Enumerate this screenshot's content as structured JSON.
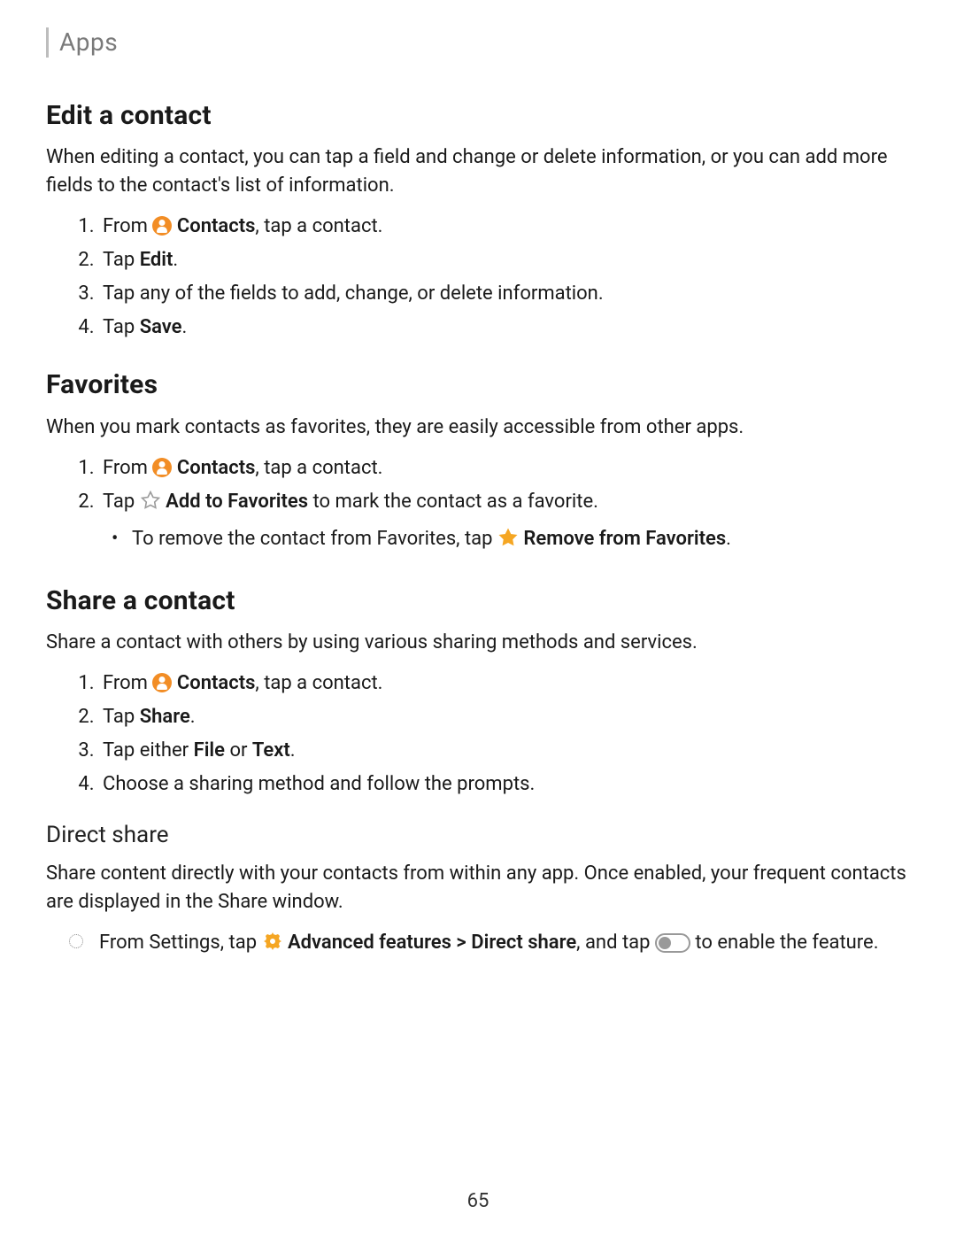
{
  "breadcrumb": "Apps",
  "page_number": "65",
  "sections": {
    "edit": {
      "title": "Edit a contact",
      "intro": "When editing a contact, you can tap a field and change or delete information, or you can add more fields to the contact's list of information.",
      "step1_pre": "From ",
      "step1_bold": "Contacts",
      "step1_post": ", tap a contact.",
      "step2_pre": "Tap ",
      "step2_bold": "Edit",
      "step2_post": ".",
      "step3": "Tap any of the fields to add, change, or delete information.",
      "step4_pre": "Tap ",
      "step4_bold": "Save",
      "step4_post": "."
    },
    "favorites": {
      "title": "Favorites",
      "intro": "When you mark contacts as favorites, they are easily accessible from other apps.",
      "step1_pre": "From ",
      "step1_bold": "Contacts",
      "step1_post": ", tap a contact.",
      "step2_pre": "Tap ",
      "step2_bold": "Add to Favorites",
      "step2_post": " to mark the contact as a favorite.",
      "sub_pre": "To remove the contact from Favorites, tap ",
      "sub_bold": "Remove from Favorites",
      "sub_post": "."
    },
    "share": {
      "title": "Share a contact",
      "intro": "Share a contact with others by using various sharing methods and services.",
      "step1_pre": "From ",
      "step1_bold": "Contacts",
      "step1_post": ", tap a contact.",
      "step2_pre": "Tap ",
      "step2_bold": "Share",
      "step2_post": ".",
      "step3_pre": "Tap either ",
      "step3_bold_a": "File",
      "step3_mid": " or ",
      "step3_bold_b": "Text",
      "step3_post": ".",
      "step4": "Choose a sharing method and follow the prompts.",
      "direct_title": "Direct share",
      "direct_intro": "Share content directly with your contacts from within any app. Once enabled, your frequent contacts are displayed in the Share window.",
      "direct_step_pre": "From Settings, tap ",
      "direct_step_bold_a": "Advanced features",
      "direct_step_sep": " > ",
      "direct_step_bold_b": "Direct share",
      "direct_step_mid": ", and tap ",
      "direct_step_post": " to enable the feature."
    }
  }
}
